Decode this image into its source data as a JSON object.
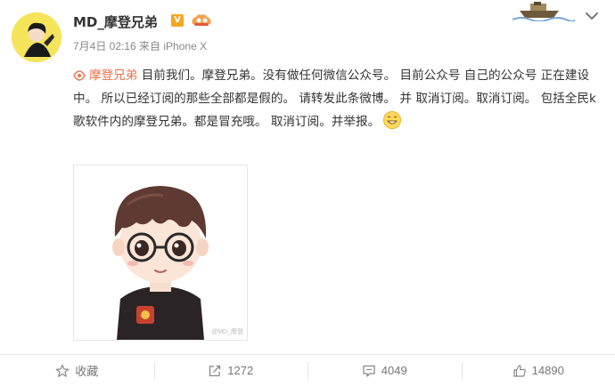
{
  "post": {
    "username": "MD_摩登兄弟",
    "verified_badge": "V",
    "meta": "7月4日 02:16 来自 iPhone X",
    "mention": "摩登兄弟",
    "content": " 目前我们。摩登兄弟。没有做任何微信公众号。 目前公众号 自己的公众号 正在建设中。 所以已经订阅的那些全部都是假的。 请转发此条微博。 并 取消订阅。取消订阅。 包括全民k歌软件内的摩登兄弟。都是冒充哦。 取消订阅。并举报。",
    "image_watermark": "@MD_摩登"
  },
  "actions": {
    "favorite_label": "收藏",
    "repost_count": "1272",
    "comment_count": "4049",
    "like_count": "14890"
  },
  "colors": {
    "accent": "#eb7350",
    "verified": "#f5a623",
    "avatar_bg": "#f6e45a"
  },
  "icons": [
    "chevron-down-icon",
    "vip-icon",
    "link-icon",
    "smile-emoji-icon",
    "star-icon",
    "repost-icon",
    "comment-icon",
    "like-icon"
  ]
}
